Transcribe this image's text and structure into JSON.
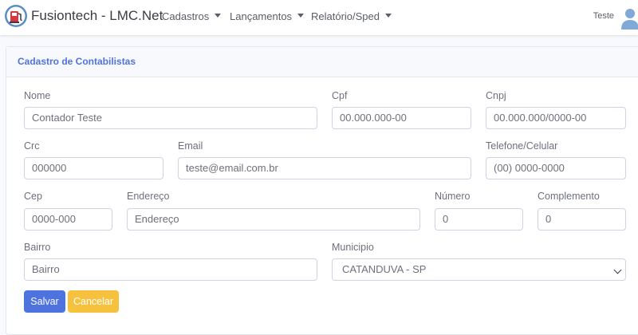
{
  "app": {
    "title": "Fusiontech - LMC.Net"
  },
  "nav": {
    "items": [
      {
        "label": "Cadastros"
      },
      {
        "label": "Lançamentos"
      },
      {
        "label": "Relatório/Sped"
      }
    ],
    "user": "Teste"
  },
  "card": {
    "title": "Cadastro de Contabilistas"
  },
  "form": {
    "nome": {
      "label": "Nome",
      "value": "Contador Teste"
    },
    "cpf": {
      "label": "Cpf",
      "value": "00.000.000-00"
    },
    "cnpj": {
      "label": "Cnpj",
      "value": "00.000.000/0000-00"
    },
    "crc": {
      "label": "Crc",
      "value": "000000"
    },
    "email": {
      "label": "Email",
      "value": "teste@email.com.br"
    },
    "telefone": {
      "label": "Telefone/Celular",
      "value": "(00) 0000-0000"
    },
    "cep": {
      "label": "Cep",
      "value": "0000-000"
    },
    "endereco": {
      "label": "Endereço",
      "value": "Endereço"
    },
    "numero": {
      "label": "Número",
      "value": "0"
    },
    "complemento": {
      "label": "Complemento",
      "value": "0"
    },
    "bairro": {
      "label": "Bairro",
      "value": "Bairro"
    },
    "municipio": {
      "label": "Municipio",
      "value": "CATANDUVA - SP"
    }
  },
  "buttons": {
    "save": "Salvar",
    "cancel": "Cancelar"
  },
  "colors": {
    "primary": "#4e73df",
    "warning": "#f6c23e",
    "text": "#6e707e",
    "logo_red": "#d9363e",
    "avatar_blue": "#7fa9d6"
  },
  "icons": {
    "logo": "fuel-pump-logo-icon",
    "avatar": "user-avatar-icon",
    "caret": "caret-down-icon",
    "select": "chevron-down-icon"
  }
}
